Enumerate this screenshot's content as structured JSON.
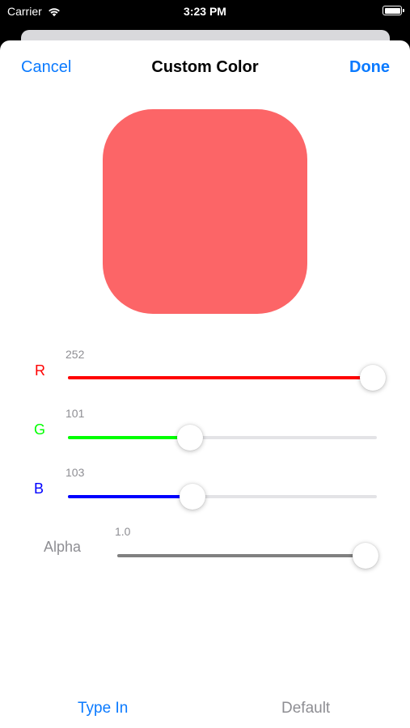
{
  "status_bar": {
    "carrier": "Carrier",
    "time": "3:23 PM",
    "wifi_icon": "wifi-icon",
    "battery_icon": "battery-icon"
  },
  "nav": {
    "cancel_label": "Cancel",
    "title": "Custom Color",
    "done_label": "Done"
  },
  "preview": {
    "color": "#fc6567"
  },
  "sliders": {
    "red": {
      "label": "R",
      "value": "252",
      "fraction": 0.988,
      "color": "#ff0000"
    },
    "green": {
      "label": "G",
      "value": "101",
      "fraction": 0.396,
      "color": "#00ff00"
    },
    "blue": {
      "label": "B",
      "value": "103",
      "fraction": 0.404,
      "color": "#0000ff"
    },
    "alpha": {
      "label": "Alpha",
      "value": "1.0",
      "fraction": 1.0,
      "color": "#808080"
    }
  },
  "bottom": {
    "type_in_label": "Type In",
    "default_label": "Default"
  },
  "colors": {
    "accent": "#0a7aff",
    "disabled": "#8e8e93"
  }
}
